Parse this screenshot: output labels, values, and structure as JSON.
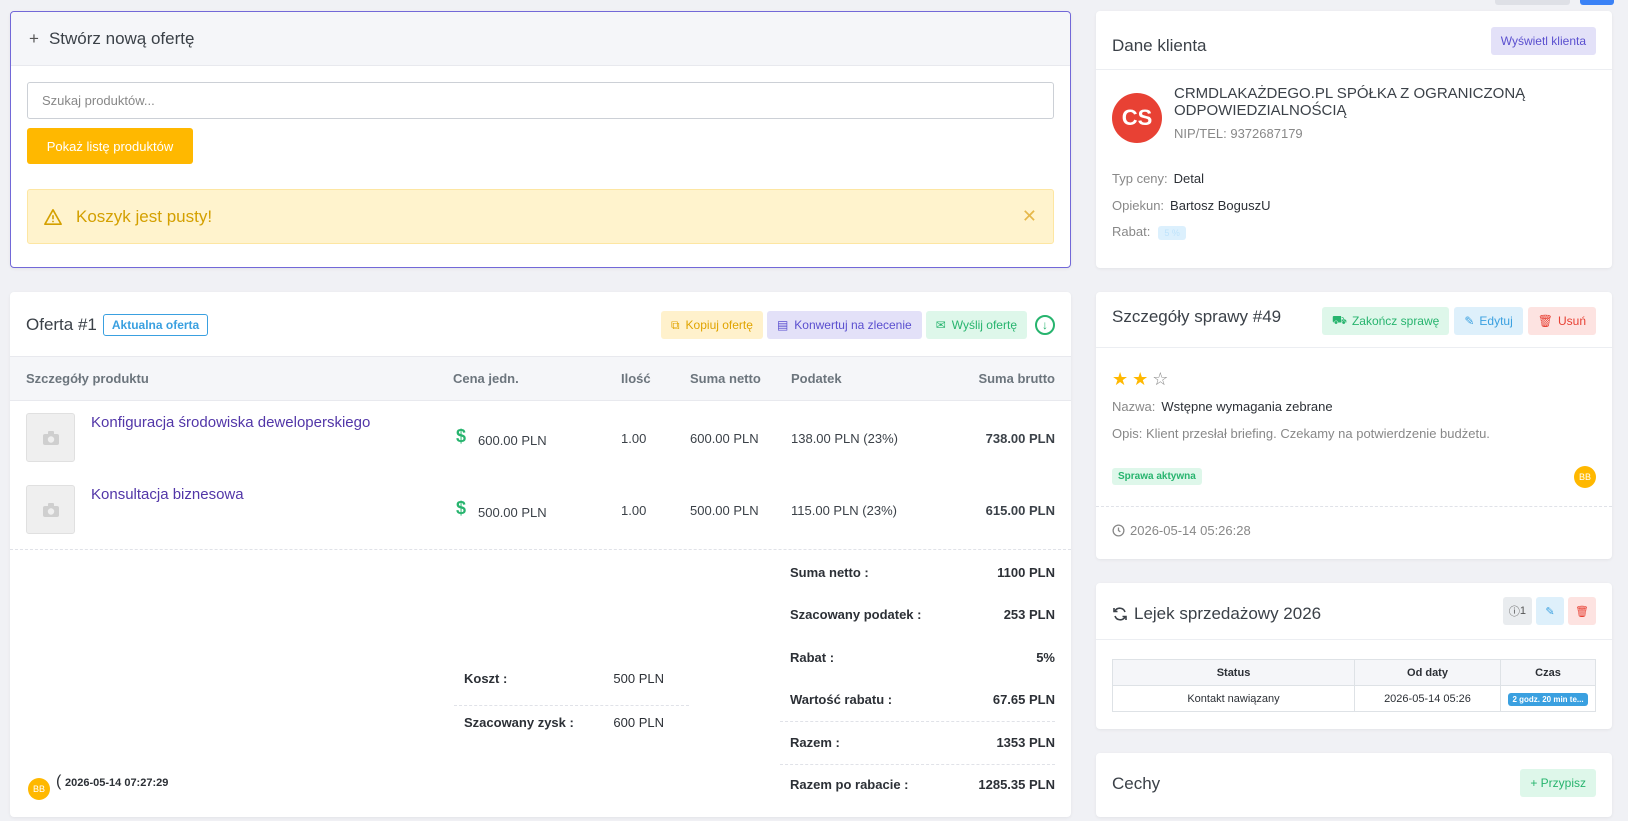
{
  "create_offer": {
    "title": "Stwórz nową ofertę",
    "search_placeholder": "Szukaj produktów...",
    "show_products_button": "Pokaż listę produktów",
    "empty_cart_alert": "Koszyk jest pusty!"
  },
  "offer": {
    "title": "Oferta #1",
    "badge": "Aktualna oferta",
    "actions": {
      "copy": "Kopiuj ofertę",
      "convert": "Konwertuj na zlecenie",
      "send": "Wyślij ofertę"
    },
    "columns": [
      "Szczegóły produktu",
      "Cena jedn.",
      "Ilość",
      "Suma netto",
      "Podatek",
      "Suma brutto"
    ],
    "products": [
      {
        "name": "Konfiguracja środowiska deweloperskiego",
        "price": "600.00 PLN",
        "qty": "1.00",
        "netto": "600.00 PLN",
        "tax": "138.00 PLN (23%)",
        "brutto": "738.00 PLN"
      },
      {
        "name": "Konsultacja biznesowa",
        "price": "500.00 PLN",
        "qty": "1.00",
        "netto": "500.00 PLN",
        "tax": "115.00 PLN (23%)",
        "brutto": "615.00 PLN"
      }
    ],
    "cost": {
      "label": "Koszt :",
      "value": "500 PLN"
    },
    "profit": {
      "label": "Szacowany zysk :",
      "value": "600 PLN"
    },
    "summary": [
      {
        "label": "Suma netto :",
        "value": "1100 PLN"
      },
      {
        "label": "Szacowany podatek :",
        "value": "253 PLN"
      },
      {
        "label": "Rabat :",
        "value": "5%"
      },
      {
        "label": "Wartość rabatu :",
        "value": "67.65 PLN"
      },
      {
        "label": "Razem :",
        "value": "1353 PLN"
      },
      {
        "label": "Razem po rabacie :",
        "value": "1285.35 PLN"
      }
    ],
    "footer": {
      "avatar": "BB",
      "paren": "(",
      "date": "2026-05-14 07:27:29"
    }
  },
  "client": {
    "title": "Dane klienta",
    "view_button": "Wyświetl klienta",
    "avatar": "CS",
    "name": "CRMDLAKAŻDEGO.PL SPÓŁKA Z OGRANICZONĄ ODPOWIEDZIALNOŚCIĄ",
    "nip": "NIP/TEL: 9372687179",
    "price_type_label": "Typ ceny:",
    "price_type": "Detal",
    "guardian_label": "Opiekun:",
    "guardian": "Bartosz BoguszU",
    "discount_label": "Rabat:",
    "discount": "5 %"
  },
  "case": {
    "title": "Szczegóły sprawy #49",
    "actions": {
      "finish": "Zakończ sprawę",
      "edit": "Edytuj",
      "delete": "Usuń"
    },
    "rating": 2,
    "rating_max": 3,
    "name_label": "Nazwa:",
    "name": "Wstępne wymagania zebrane",
    "desc": "Opis: Klient przesłał briefing. Czekamy na potwierdzenie budżetu.",
    "status": "Sprawa aktywna",
    "avatar": "BB",
    "date": "2026-05-14 05:26:28"
  },
  "funnel": {
    "title": "Lejek sprzedażowy 2026",
    "count": "1",
    "columns": [
      "Status",
      "Od daty",
      "Czas"
    ],
    "rows": [
      {
        "status": "Kontakt nawiązany",
        "from": "2026-05-14 05:26",
        "time": "2 godz. 20 min te..."
      }
    ]
  },
  "features": {
    "title": "Cechy",
    "assign_button": "Przypisz"
  },
  "colors": {
    "accent": "#7268d8",
    "warning": "#ffb800",
    "success": "#27b46e",
    "danger": "#e84134",
    "info": "#3aa0e0"
  }
}
